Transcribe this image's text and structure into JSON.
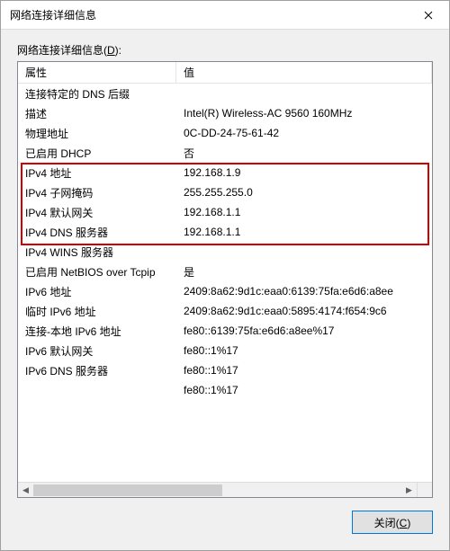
{
  "window": {
    "title": "网络连接详细信息"
  },
  "content": {
    "list_label": "网络连接详细信息(",
    "list_label_mnemonic": "D",
    "list_label_suffix": "):",
    "header_property": "属性",
    "header_value": "值",
    "rows": [
      {
        "prop": "连接特定的 DNS 后缀",
        "val": ""
      },
      {
        "prop": "描述",
        "val": "Intel(R) Wireless-AC 9560 160MHz"
      },
      {
        "prop": "物理地址",
        "val": "0C-DD-24-75-61-42"
      },
      {
        "prop": "已启用 DHCP",
        "val": "否"
      },
      {
        "prop": "IPv4 地址",
        "val": "192.168.1.9"
      },
      {
        "prop": "IPv4 子网掩码",
        "val": "255.255.255.0"
      },
      {
        "prop": "IPv4 默认网关",
        "val": "192.168.1.1"
      },
      {
        "prop": "IPv4 DNS 服务器",
        "val": "192.168.1.1"
      },
      {
        "prop": "IPv4 WINS 服务器",
        "val": ""
      },
      {
        "prop": "已启用 NetBIOS over Tcpip",
        "val": "是"
      },
      {
        "prop": "IPv6 地址",
        "val": "2409:8a62:9d1c:eaa0:6139:75fa:e6d6:a8ee"
      },
      {
        "prop": "临时 IPv6 地址",
        "val": "2409:8a62:9d1c:eaa0:5895:4174:f654:9c6"
      },
      {
        "prop": "连接-本地 IPv6 地址",
        "val": "fe80::6139:75fa:e6d6:a8ee%17"
      },
      {
        "prop": "IPv6 默认网关",
        "val": "fe80::1%17"
      },
      {
        "prop": "IPv6 DNS 服务器",
        "val": "fe80::1%17"
      },
      {
        "prop": "",
        "val": "fe80::1%17"
      }
    ],
    "close_button": "关闭(",
    "close_button_mnemonic": "C",
    "close_button_suffix": ")"
  }
}
